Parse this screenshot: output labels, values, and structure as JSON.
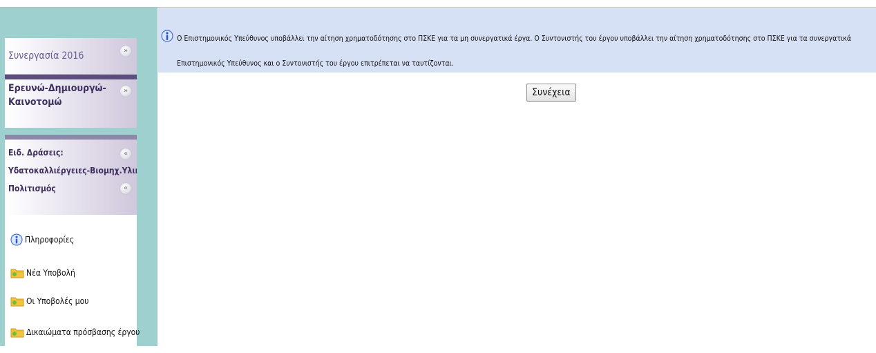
{
  "sidebar": {
    "sections": [
      {
        "title": "Συνεργασία 2016",
        "toggle_icon": "chevron-double-down-icon"
      },
      {
        "title_line1": "Ερευνώ-Δημιουργώ-",
        "title_line2": "Καινοτομώ",
        "toggle_icon": "chevron-double-down-icon"
      },
      {
        "title_line1": "Ειδ. Δράσεις:",
        "title_line2": "Υδατοκαλλιέργειες-Βιομηχ.Υλικά-",
        "title_line3": "Πολιτισμός",
        "toggle_icon": "chevron-double-up-icon"
      }
    ],
    "links": [
      {
        "label": "Πληροφορίες",
        "icon": "info-icon"
      },
      {
        "label": "Νέα Υποβολή",
        "icon": "folder-icon"
      },
      {
        "label": "Οι Υποβολές μου",
        "icon": "folder-icon"
      },
      {
        "label": "Δικαιώματα πρόσβασης έργου",
        "icon": "folder-icon"
      }
    ]
  },
  "info": {
    "line1": "Ο Επιστημονικός Υπεύθυνος υποβάλλει την αίτηση χρηματοδότησης στο ΠΣΚΕ για τα μη συνεργατικά έργα. Ο Συντονιστής του έργου υποβάλλει την αίτηση χρηματοδότησης στο ΠΣΚΕ για τα συνεργατικά",
    "line2": "Επιστημονικός Υπεύθυνος και ο Συντονιστής του έργου επιτρέπεται να ταυτίζονται.",
    "icon": "info-icon"
  },
  "actions": {
    "continue_label": "Συνέχεια"
  },
  "colors": {
    "left_panel_bg": "#9fd0d0",
    "info_bar_bg": "#d6e1f5",
    "section_title": "#6b5a92",
    "section_title_bold": "#3f2f5e"
  }
}
